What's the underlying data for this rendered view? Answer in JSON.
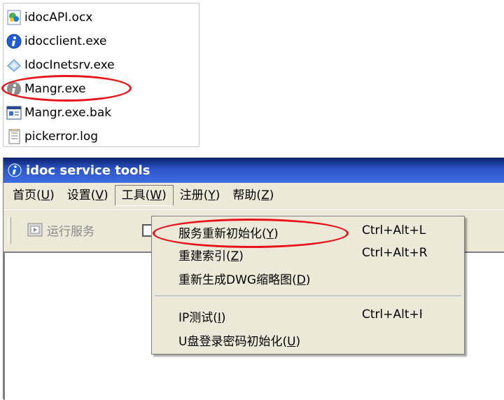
{
  "files": [
    {
      "name": "idocAPI.ocx",
      "icon": "ocx-file-icon"
    },
    {
      "name": "idocclient.exe",
      "icon": "info-app-icon"
    },
    {
      "name": "IdocInetsrv.exe",
      "icon": "network-app-icon"
    },
    {
      "name": "Mangr.exe",
      "icon": "info-app-gray-icon"
    },
    {
      "name": "Mangr.exe.bak",
      "icon": "bak-file-icon"
    },
    {
      "name": "pickerror.log",
      "icon": "log-file-icon"
    }
  ],
  "window": {
    "title": "idoc service tools"
  },
  "menu": {
    "items": [
      {
        "label": "首页(",
        "key": "U",
        "end": ")"
      },
      {
        "label": "设置(",
        "key": "V",
        "end": ")"
      },
      {
        "label": "工具(",
        "key": "W",
        "end": ")"
      },
      {
        "label": "注册(",
        "key": "Y",
        "end": ")"
      },
      {
        "label": "帮助(",
        "key": "Z",
        "end": ")"
      }
    ]
  },
  "toolbar": {
    "run_service": "运行服务"
  },
  "tools_menu": {
    "items": [
      {
        "label": "服务重新初始化(",
        "key": "Y",
        "end": ")",
        "shortcut": "Ctrl+Alt+L"
      },
      {
        "label": "重建索引(",
        "key": "Z",
        "end": ")",
        "shortcut": "Ctrl+Alt+R"
      },
      {
        "label": "重新生成DWG缩略图(",
        "key": "D",
        "end": ")",
        "shortcut": ""
      },
      {
        "label": "IP测试(",
        "key": "I",
        "end": ")",
        "shortcut": "Ctrl+Alt+I"
      },
      {
        "label": "U盘登录密码初始化(",
        "key": "U",
        "end": ")",
        "shortcut": ""
      }
    ]
  },
  "colors": {
    "annotation": "#e8141b",
    "title_bar": "#2e54c8"
  }
}
